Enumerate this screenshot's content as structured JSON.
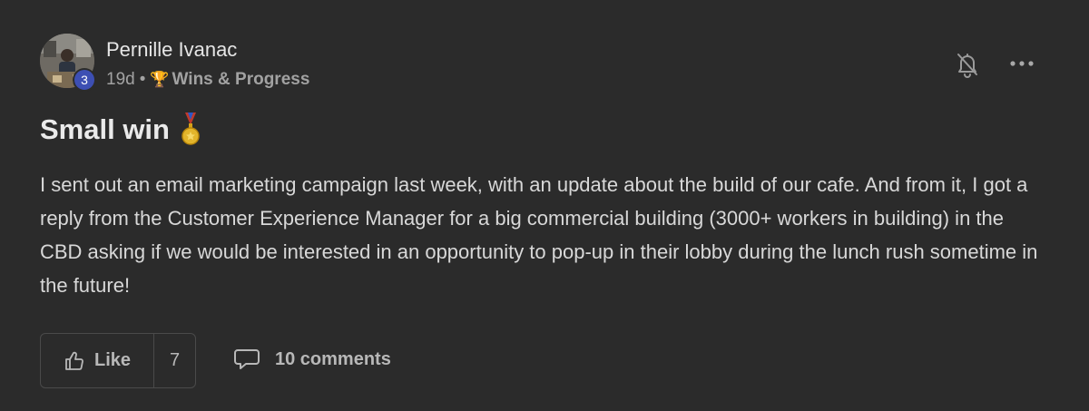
{
  "author": {
    "name": "Pernille Ivanac",
    "level": "3",
    "avatar_icon": "person-photo-avatar"
  },
  "meta": {
    "age": "19d",
    "separator": "•",
    "category_icon": "🏆",
    "category": "Wins & Progress"
  },
  "actions": {
    "bell_icon": "bell-off-icon",
    "more_icon": "more-horizontal-icon"
  },
  "post": {
    "title": "Small win",
    "title_emoji": "medal",
    "body": "I sent out an email marketing campaign last week, with an update about the build of our cafe. And from it, I got a reply from the Customer Experience Manager for a big commercial building (3000+ workers in building) in the CBD asking if we would be interested in an opportunity to pop-up in their lobby during the lunch rush sometime in the future!"
  },
  "footer": {
    "like_label": "Like",
    "like_count": "7",
    "comments_label": "10 comments"
  },
  "colors": {
    "background": "#2b2b2b",
    "badge": "#3d4fb3",
    "text_primary": "#e8e8e8",
    "text_muted": "#a2a2a2"
  }
}
